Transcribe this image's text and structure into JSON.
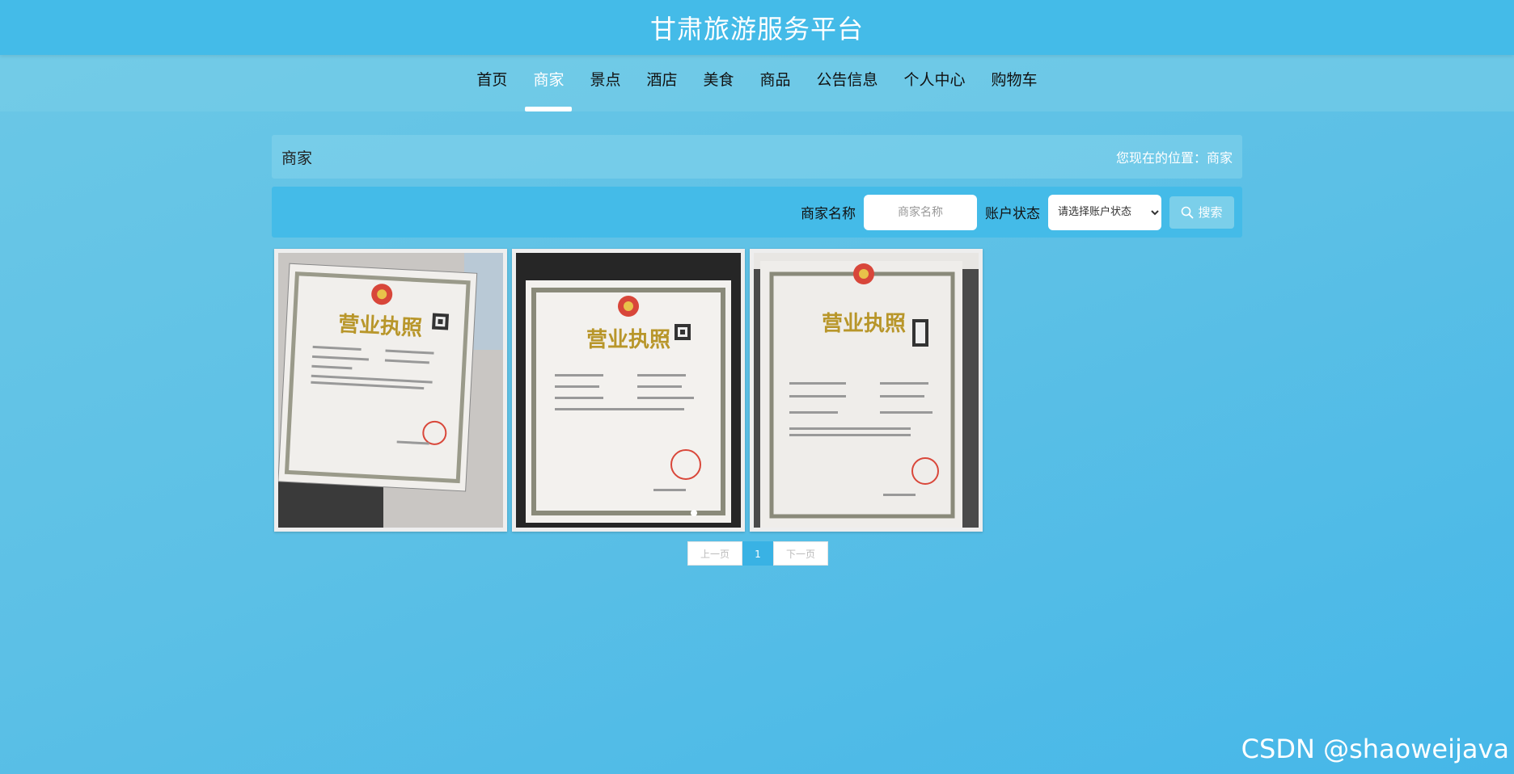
{
  "header": {
    "title": "甘肃旅游服务平台"
  },
  "nav": {
    "items": [
      {
        "label": "首页"
      },
      {
        "label": "商家",
        "active": true
      },
      {
        "label": "景点"
      },
      {
        "label": "酒店"
      },
      {
        "label": "美食"
      },
      {
        "label": "商品"
      },
      {
        "label": "公告信息"
      },
      {
        "label": "个人中心"
      },
      {
        "label": "购物车"
      }
    ]
  },
  "breadcrumb": {
    "title": "商家",
    "location_label": "您现在的位置：",
    "location_value": "商家"
  },
  "search": {
    "name_label": "商家名称",
    "name_placeholder": "商家名称",
    "status_label": "账户状态",
    "status_selected": "请选择账户状态",
    "button_label": "搜索",
    "button_icon": "search-icon"
  },
  "cards": [
    {
      "image": "business-license-photo-1",
      "license_title": "营业执照"
    },
    {
      "image": "business-license-photo-2",
      "license_title": "营业执照"
    },
    {
      "image": "business-license-photo-3",
      "license_title": "营业执照"
    }
  ],
  "pagination": {
    "prev": "上一页",
    "current": "1",
    "next": "下一页"
  },
  "watermark": "CSDN @shaoweijava",
  "colors": {
    "topbar": "#44bbe8",
    "accent": "#39b2e4",
    "background": "#5cc0e6"
  }
}
